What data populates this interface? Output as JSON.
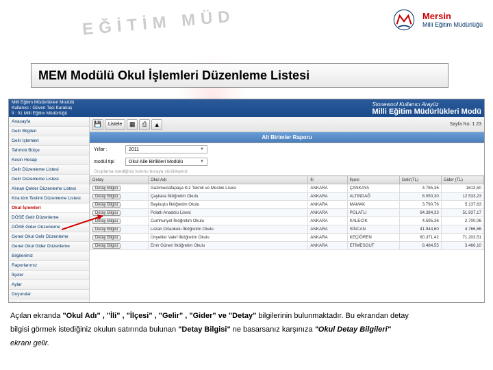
{
  "watermark": "EĞİTİM MÜD",
  "logo": {
    "city": "Mersin",
    "dept": "Milli Eğitim Müdürlüğü"
  },
  "title": "MEM Modülü Okul İşlemleri Düzenleme Listesi",
  "header": {
    "line1": "Milli Eğitim Müdürlükleri Modülü",
    "line2": "Kullanıcı : Güven Taci Karakuş",
    "line3": "İl : 01 Milli Eğitim Müdürlüğü",
    "rightSmall": "Stonewool Kullanıcı Arayüz",
    "rightBig": "Milli Eğitim Müdürlükleri Modü"
  },
  "sidebar": {
    "items": [
      "Anasayfa",
      "Gelir Bilgileri",
      "Gelir İşlemleri",
      "Tahmini Bütçe",
      "Kesin Hesap",
      "Gelir Düzenleme Listesi",
      "Gelir Düzenleme Listesi",
      "Alınan Çekler Düzenleme Listesi",
      "Kira tüm Teslimi Düzenleme Listesi",
      "Okul İşlemleri",
      "DÖSE Gelir Düzenleme",
      "DÖSE Gider Düzenleme",
      "Genel Okul Gelir Düzenleme",
      "Genel Okul Gider Düzenleme",
      "Bilgilerimiz",
      "Raporlarımız",
      "İlçeler",
      "Aylar",
      "Duyurular",
      "Yardım"
    ],
    "activeIndex": 9
  },
  "toolbar": {
    "listLabel": "Listele",
    "pageLabel": "Sayfa No: 1 23"
  },
  "reportTitle": "Alt Birimler Raporu",
  "filters": {
    "yearLabel": "Yıllar :",
    "yearValue": "2011",
    "typeLabel": "modül tipi",
    "typeValue": "Okul Aile Birlikleri Modülü"
  },
  "gridNote": "Gruplama istediğiniz kolonu buraya sürükleyiniz",
  "grid": {
    "columns": [
      "Detay",
      "Okul Adı",
      "İli",
      "İlçesi",
      "Gelir(TL)",
      "Gider (TL)"
    ],
    "detayLabel": "Detay Bilgisi",
    "rows": [
      {
        "okul": "Gazimustafapaşa Kız Teknik ve Meslek Lisesi",
        "il": "ANKARA",
        "ilce": "ÇANKAYA",
        "gelir": "4.785,36",
        "gider": "1613,50"
      },
      {
        "okul": "Çaykara İlköğretim Okulu",
        "il": "ANKARA",
        "ilce": "ALTINDAĞ",
        "gelir": "8.050,30",
        "gider": "12.533,23"
      },
      {
        "okul": "Baykuşlu İlköğretim Okulu",
        "il": "ANKARA",
        "ilce": "MAMAK",
        "gelir": "3.790,76",
        "gider": "5.137,63"
      },
      {
        "okul": "Polatlı Anadolu Lisesi",
        "il": "ANKARA",
        "ilce": "POLATLI",
        "gelir": "64.384,33",
        "gider": "51.937,17"
      },
      {
        "okul": "Cumhuriyet İlköğretim Okulu",
        "il": "ANKARA",
        "ilce": "KALECİK",
        "gelir": "4.595,36",
        "gider": "2.700,06"
      },
      {
        "okul": "Lozan Ortaokulu İlköğretim Okulu",
        "il": "ANKARA",
        "ilce": "SİNCAN",
        "gelir": "41.944,60",
        "gider": "4.766,86"
      },
      {
        "okul": "Ünyeliler Vakıf İlköğretim Okulu",
        "il": "ANKARA",
        "ilce": "KEÇİÖREN",
        "gelir": "60.371,42",
        "gider": "71.203,51"
      },
      {
        "okul": "Emir Güneri İlköğretim Okulu",
        "il": "ANKARA",
        "ilce": "ETİMESGUT",
        "gelir": "8.484,55",
        "gider": "3.466,10"
      }
    ]
  },
  "description": {
    "p1a": "Açılan ekranda ",
    "p1b": "\"Okul Adı\" , \"İli\" , \"İlçesi\" , \"Gelir\" , \"Gider\" ve \"Detay\" ",
    "p1c": "bilgilerinin bulunmaktadır. Bu ekrandan detay",
    "p2a": "bilgisi görmek istediğiniz okulun satırında bulunan ",
    "p2b": "\"Detay Bilgisi\"",
    "p2c": " ne basarsanız karşınıza ",
    "p2d": "\"Okul Detay Bilgileri\"",
    "p3": "ekranı gelir."
  }
}
